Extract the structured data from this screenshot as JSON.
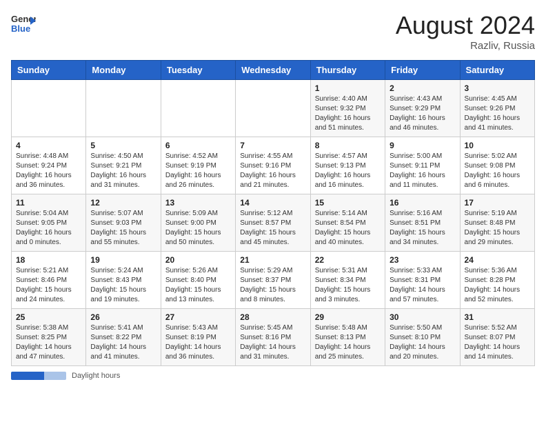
{
  "header": {
    "logo_line1": "General",
    "logo_line2": "Blue",
    "month_year": "August 2024",
    "location": "Razliv, Russia"
  },
  "footer": {
    "label": "Daylight hours"
  },
  "days_of_week": [
    "Sunday",
    "Monday",
    "Tuesday",
    "Wednesday",
    "Thursday",
    "Friday",
    "Saturday"
  ],
  "weeks": [
    [
      {
        "day": "",
        "info": ""
      },
      {
        "day": "",
        "info": ""
      },
      {
        "day": "",
        "info": ""
      },
      {
        "day": "",
        "info": ""
      },
      {
        "day": "1",
        "info": "Sunrise: 4:40 AM\nSunset: 9:32 PM\nDaylight: 16 hours\nand 51 minutes."
      },
      {
        "day": "2",
        "info": "Sunrise: 4:43 AM\nSunset: 9:29 PM\nDaylight: 16 hours\nand 46 minutes."
      },
      {
        "day": "3",
        "info": "Sunrise: 4:45 AM\nSunset: 9:26 PM\nDaylight: 16 hours\nand 41 minutes."
      }
    ],
    [
      {
        "day": "4",
        "info": "Sunrise: 4:48 AM\nSunset: 9:24 PM\nDaylight: 16 hours\nand 36 minutes."
      },
      {
        "day": "5",
        "info": "Sunrise: 4:50 AM\nSunset: 9:21 PM\nDaylight: 16 hours\nand 31 minutes."
      },
      {
        "day": "6",
        "info": "Sunrise: 4:52 AM\nSunset: 9:19 PM\nDaylight: 16 hours\nand 26 minutes."
      },
      {
        "day": "7",
        "info": "Sunrise: 4:55 AM\nSunset: 9:16 PM\nDaylight: 16 hours\nand 21 minutes."
      },
      {
        "day": "8",
        "info": "Sunrise: 4:57 AM\nSunset: 9:13 PM\nDaylight: 16 hours\nand 16 minutes."
      },
      {
        "day": "9",
        "info": "Sunrise: 5:00 AM\nSunset: 9:11 PM\nDaylight: 16 hours\nand 11 minutes."
      },
      {
        "day": "10",
        "info": "Sunrise: 5:02 AM\nSunset: 9:08 PM\nDaylight: 16 hours\nand 6 minutes."
      }
    ],
    [
      {
        "day": "11",
        "info": "Sunrise: 5:04 AM\nSunset: 9:05 PM\nDaylight: 16 hours\nand 0 minutes."
      },
      {
        "day": "12",
        "info": "Sunrise: 5:07 AM\nSunset: 9:03 PM\nDaylight: 15 hours\nand 55 minutes."
      },
      {
        "day": "13",
        "info": "Sunrise: 5:09 AM\nSunset: 9:00 PM\nDaylight: 15 hours\nand 50 minutes."
      },
      {
        "day": "14",
        "info": "Sunrise: 5:12 AM\nSunset: 8:57 PM\nDaylight: 15 hours\nand 45 minutes."
      },
      {
        "day": "15",
        "info": "Sunrise: 5:14 AM\nSunset: 8:54 PM\nDaylight: 15 hours\nand 40 minutes."
      },
      {
        "day": "16",
        "info": "Sunrise: 5:16 AM\nSunset: 8:51 PM\nDaylight: 15 hours\nand 34 minutes."
      },
      {
        "day": "17",
        "info": "Sunrise: 5:19 AM\nSunset: 8:48 PM\nDaylight: 15 hours\nand 29 minutes."
      }
    ],
    [
      {
        "day": "18",
        "info": "Sunrise: 5:21 AM\nSunset: 8:46 PM\nDaylight: 15 hours\nand 24 minutes."
      },
      {
        "day": "19",
        "info": "Sunrise: 5:24 AM\nSunset: 8:43 PM\nDaylight: 15 hours\nand 19 minutes."
      },
      {
        "day": "20",
        "info": "Sunrise: 5:26 AM\nSunset: 8:40 PM\nDaylight: 15 hours\nand 13 minutes."
      },
      {
        "day": "21",
        "info": "Sunrise: 5:29 AM\nSunset: 8:37 PM\nDaylight: 15 hours\nand 8 minutes."
      },
      {
        "day": "22",
        "info": "Sunrise: 5:31 AM\nSunset: 8:34 PM\nDaylight: 15 hours\nand 3 minutes."
      },
      {
        "day": "23",
        "info": "Sunrise: 5:33 AM\nSunset: 8:31 PM\nDaylight: 14 hours\nand 57 minutes."
      },
      {
        "day": "24",
        "info": "Sunrise: 5:36 AM\nSunset: 8:28 PM\nDaylight: 14 hours\nand 52 minutes."
      }
    ],
    [
      {
        "day": "25",
        "info": "Sunrise: 5:38 AM\nSunset: 8:25 PM\nDaylight: 14 hours\nand 47 minutes."
      },
      {
        "day": "26",
        "info": "Sunrise: 5:41 AM\nSunset: 8:22 PM\nDaylight: 14 hours\nand 41 minutes."
      },
      {
        "day": "27",
        "info": "Sunrise: 5:43 AM\nSunset: 8:19 PM\nDaylight: 14 hours\nand 36 minutes."
      },
      {
        "day": "28",
        "info": "Sunrise: 5:45 AM\nSunset: 8:16 PM\nDaylight: 14 hours\nand 31 minutes."
      },
      {
        "day": "29",
        "info": "Sunrise: 5:48 AM\nSunset: 8:13 PM\nDaylight: 14 hours\nand 25 minutes."
      },
      {
        "day": "30",
        "info": "Sunrise: 5:50 AM\nSunset: 8:10 PM\nDaylight: 14 hours\nand 20 minutes."
      },
      {
        "day": "31",
        "info": "Sunrise: 5:52 AM\nSunset: 8:07 PM\nDaylight: 14 hours\nand 14 minutes."
      }
    ]
  ]
}
